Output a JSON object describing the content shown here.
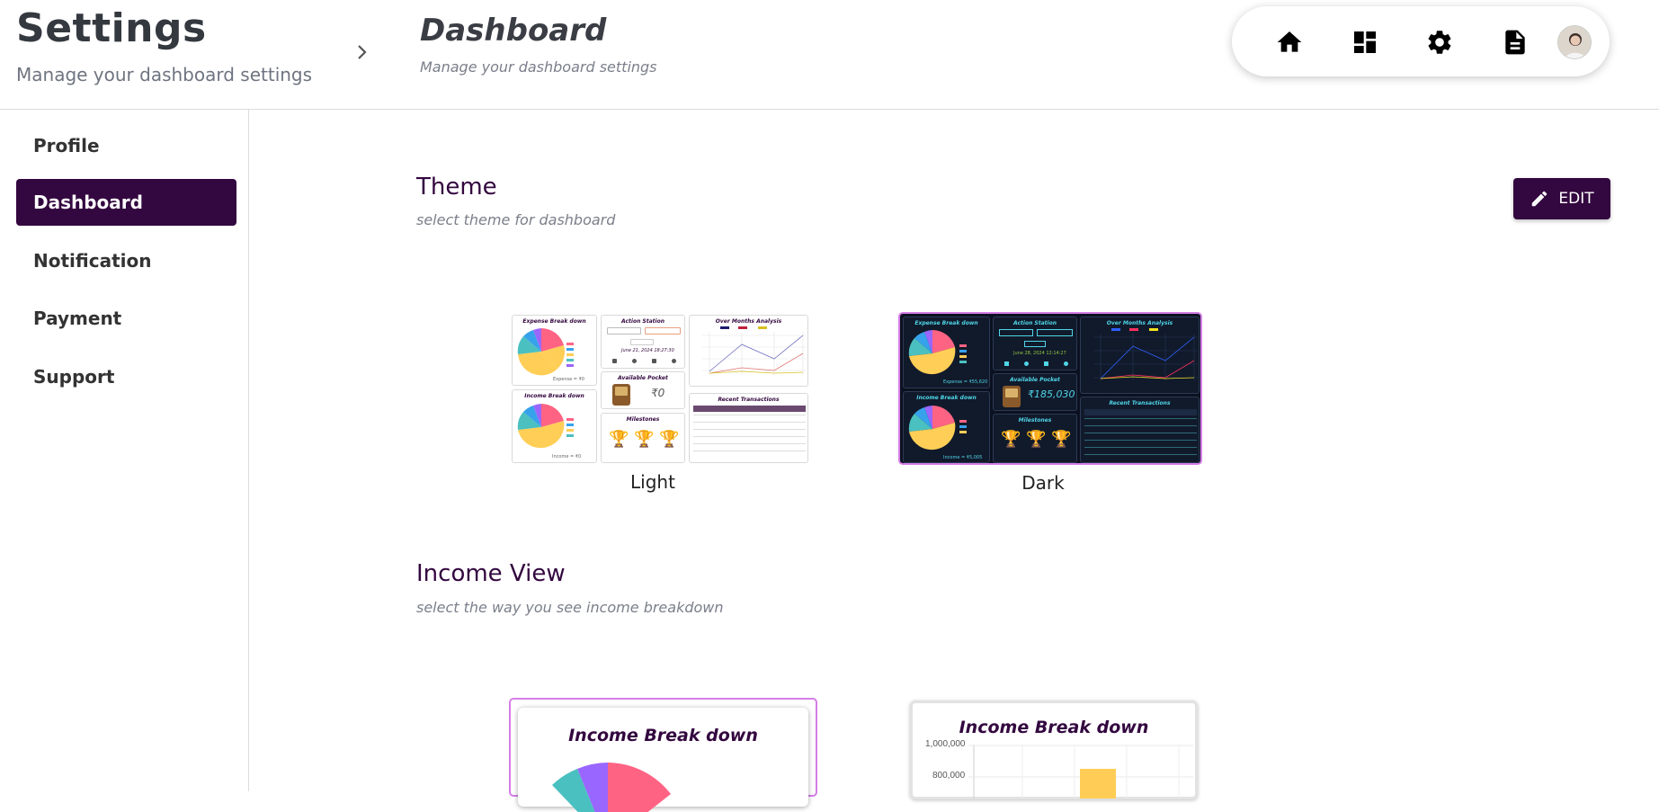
{
  "header": {
    "settings_title": "Settings",
    "settings_subtitle": "Manage your dashboard settings",
    "page_title": "Dashboard",
    "page_subtitle": "Manage your dashboard settings",
    "nav_icons": [
      "home-icon",
      "dashboard-icon",
      "gear-icon",
      "document-icon",
      "avatar"
    ]
  },
  "sidebar": {
    "items": [
      {
        "label": "Profile",
        "active": false
      },
      {
        "label": "Dashboard",
        "active": true
      },
      {
        "label": "Notification",
        "active": false
      },
      {
        "label": "Payment",
        "active": false
      },
      {
        "label": "Support",
        "active": false
      }
    ]
  },
  "theme": {
    "title": "Theme",
    "subtitle": "select theme for dashboard",
    "edit_label": "EDIT",
    "options": [
      {
        "label": "Light",
        "selected": false
      },
      {
        "label": "Dark",
        "selected": true
      }
    ],
    "preview": {
      "expense_title": "Expense Break down",
      "income_title": "Income Break down",
      "action_title": "Action Station",
      "analysis_title": "Over Months Analysis",
      "pocket_title": "Available Pocket",
      "milestones_title": "Milestones",
      "transactions_title": "Recent Transactions",
      "light_pocket_value": "₹0",
      "dark_pocket_value": "₹185,030",
      "light_expense_total": "Expense = ₹0",
      "light_income_total": "Income = ₹0",
      "dark_expense_total": "Expense = ₹55,620",
      "dark_income_total": "Income = ₹5,005",
      "light_date": "June 21, 2024 18:27:30",
      "dark_date": "June 28, 2024 12:14:27"
    }
  },
  "income_view": {
    "title": "Income View",
    "subtitle": "select the way you see income breakdown",
    "pie_card_title": "Income Break down",
    "bar_card_title": "Income Break down",
    "bar_axis_ticks": [
      "1,000,000",
      "800,000"
    ]
  },
  "colors": {
    "primary": "#33073f",
    "selected_border": "#d57ee6",
    "pie": [
      "#ff6384",
      "#36a2eb",
      "#ffce56",
      "#4bc0c0",
      "#9966ff"
    ],
    "bar": "#ffcd56"
  }
}
